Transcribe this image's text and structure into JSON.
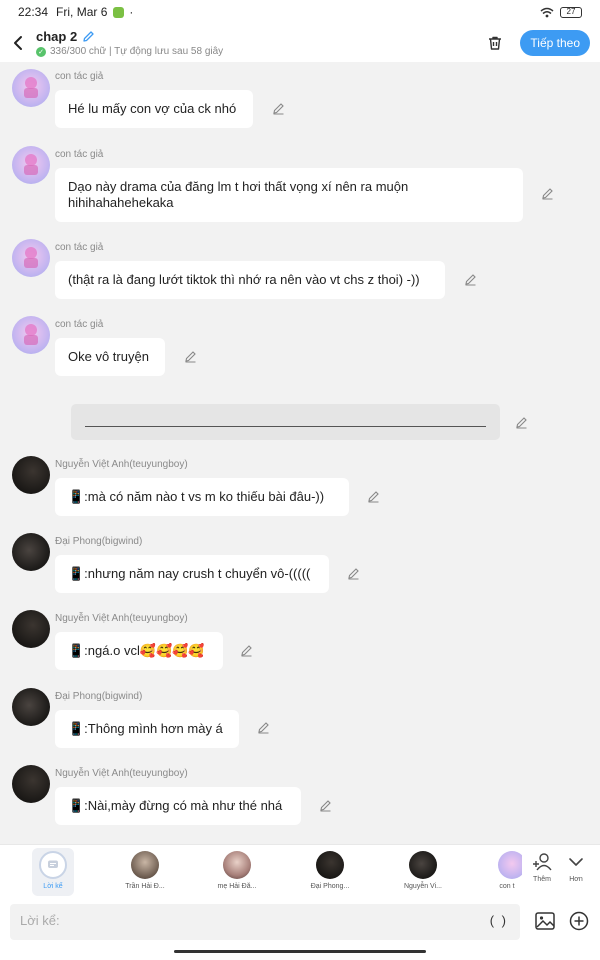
{
  "status_bar": {
    "time": "22:34",
    "date": "Fri, Mar 6",
    "dot": "·",
    "battery": "27"
  },
  "header": {
    "title": "chap 2",
    "subtitle": "336/300 chữ | Tự động lưu sau 58 giây",
    "continue_label": "Tiếp theo",
    "accent": "#3d9bf3"
  },
  "messages": [
    {
      "sender": "con tác giả",
      "text": "Hé lu mấy con vợ của ck nhó",
      "avatar": "author-avatar"
    },
    {
      "sender": "con tác giả",
      "text": "Dạo này drama của đăng lm t hơi thất vọng xí nên ra muộn hihihahahehekaka",
      "avatar": "author-avatar"
    },
    {
      "sender": "con tác giả",
      "text": "(thật ra là đang lướt tiktok thì nhớ ra nên vào vt chs z thoi) -))",
      "avatar": "author-avatar"
    },
    {
      "sender": "con tác giả",
      "text": "Oke vô truyện",
      "avatar": "author-avatar"
    },
    {
      "sender": "Nguyễn Việt Anh(teuyungboy)",
      "text": "📱:mà có năm nào t vs m ko thiếu bài đâu-))",
      "avatar": "dark-avatar"
    },
    {
      "sender": "Đại Phong(bigwind)",
      "text": "📱:nhưng năm nay crush t chuyển vô-(((((",
      "avatar": "dark-avatar"
    },
    {
      "sender": "Nguyễn Việt Anh(teuyungboy)",
      "text": "📱:ngá.o vcl🥰🥰🥰🥰",
      "avatar": "dark-avatar"
    },
    {
      "sender": "Đại Phong(bigwind)",
      "text": "📱:Thông mình hơn mày á",
      "avatar": "dark-avatar"
    },
    {
      "sender": "Nguyễn Việt Anh(teuyungboy)",
      "text": "📱:Nài,mày đừng có mà như thé nhá",
      "avatar": "dark-avatar"
    }
  ],
  "characters": [
    {
      "label": "Lời kể",
      "active": true
    },
    {
      "label": "Trần Hải Đ...",
      "active": false
    },
    {
      "label": "mẹ Hải Đă...",
      "active": false
    },
    {
      "label": "Đại Phong...",
      "active": false
    },
    {
      "label": "Nguyễn Vi...",
      "active": false
    },
    {
      "label": "con t",
      "active": false
    }
  ],
  "tools": {
    "add_label": "Thêm",
    "more_label": "Hơn"
  },
  "input": {
    "placeholder": "Lời kể:",
    "paren_label": "( )"
  }
}
